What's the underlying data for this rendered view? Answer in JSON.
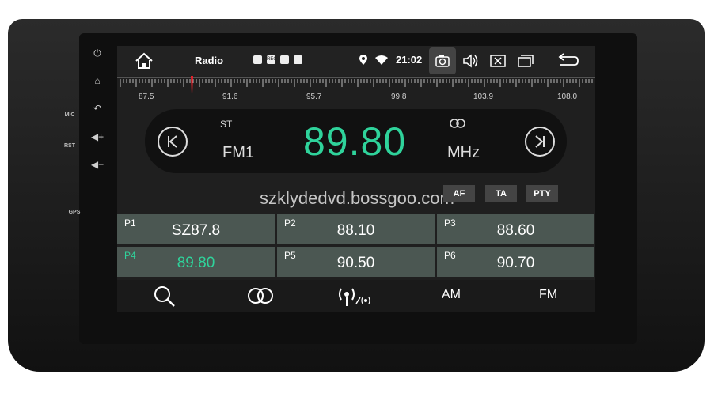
{
  "status": {
    "title": "Radio",
    "clock": "21:02",
    "rec_badge": "REC"
  },
  "ruler": {
    "labels": [
      "87.5",
      "91.6",
      "95.7",
      "99.8",
      "103.9",
      "108.0"
    ]
  },
  "tuner": {
    "stereo_label": "ST",
    "band": "FM1",
    "frequency": "89.80",
    "unit": "MHz",
    "accent_color": "#2fd39b"
  },
  "watermark": "szklydedvd.bossgoo.com",
  "options": {
    "af": "AF",
    "ta": "TA",
    "pty": "PTY"
  },
  "presets": [
    {
      "name": "P1",
      "value": "SZ87.8"
    },
    {
      "name": "P2",
      "value": "88.10"
    },
    {
      "name": "P3",
      "value": "88.60"
    },
    {
      "name": "P4",
      "value": "89.80"
    },
    {
      "name": "P5",
      "value": "90.50"
    },
    {
      "name": "P6",
      "value": "90.70"
    }
  ],
  "bottom": {
    "am": "AM",
    "fm": "FM"
  },
  "side": {
    "mic": "MIC",
    "rst": "RST",
    "gps": "GPS"
  }
}
